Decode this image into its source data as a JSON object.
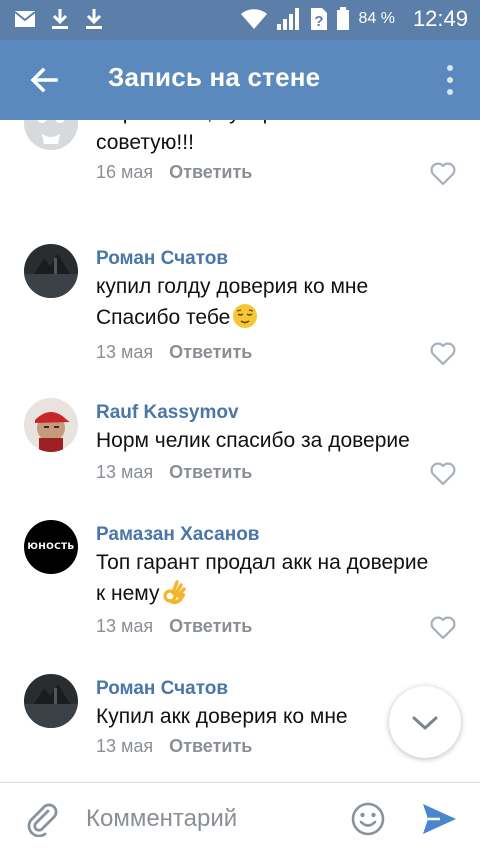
{
  "status_bar": {
    "battery_percent": "84 %",
    "time": "12:49",
    "icons": [
      "mail-icon",
      "download-icon",
      "download-icon",
      "wifi-icon",
      "signal-icon",
      "unknown-sim-icon",
      "battery-icon"
    ]
  },
  "app_bar": {
    "title": "Запись на стене",
    "back_icon": "arrow-left-icon",
    "menu_icon": "more-vertical-icon"
  },
  "comments": [
    {
      "author": "",
      "lines": [
        "Парень топ, супер. Всем",
        "советую!!!"
      ],
      "date": "16 мая",
      "reply_label": "Ответить",
      "avatar": "default-avatar"
    },
    {
      "author": "Роман Счатов",
      "lines": [
        "купил голду  доверия ко мне",
        "Спасибо тебе"
      ],
      "emoji": "relieved-face",
      "date": "13 мая",
      "reply_label": "Ответить",
      "avatar": "dark-landscape-avatar"
    },
    {
      "author": "Rauf Kassymov",
      "lines": [
        "Норм челик спасибо за доверие"
      ],
      "date": "13 мая",
      "reply_label": "Ответить",
      "avatar": "person-red-cap-avatar"
    },
    {
      "author": "Рамазан Хасанов",
      "lines": [
        "Топ гарант продал акк на доверие",
        "к нему"
      ],
      "emoji": "ok-hand",
      "date": "13 мая",
      "reply_label": "Ответить",
      "avatar": "black-logo-avatar",
      "avatar_text": "ЮНОСТЬ"
    },
    {
      "author": "Роман Счатов",
      "lines": [
        "Купил акк доверия ко мне"
      ],
      "date": "13 мая",
      "reply_label": "Ответить",
      "avatar": "dark-landscape-avatar"
    }
  ],
  "composer": {
    "placeholder": "Комментарий",
    "attach_icon": "paperclip-icon",
    "emoji_icon": "smile-icon",
    "send_icon": "send-icon"
  },
  "colors": {
    "status_bar": "#5b7fa9",
    "app_bar": "#5b88bd",
    "author": "#4a76a8",
    "meta": "#8a8f96",
    "send": "#4a86d0"
  }
}
